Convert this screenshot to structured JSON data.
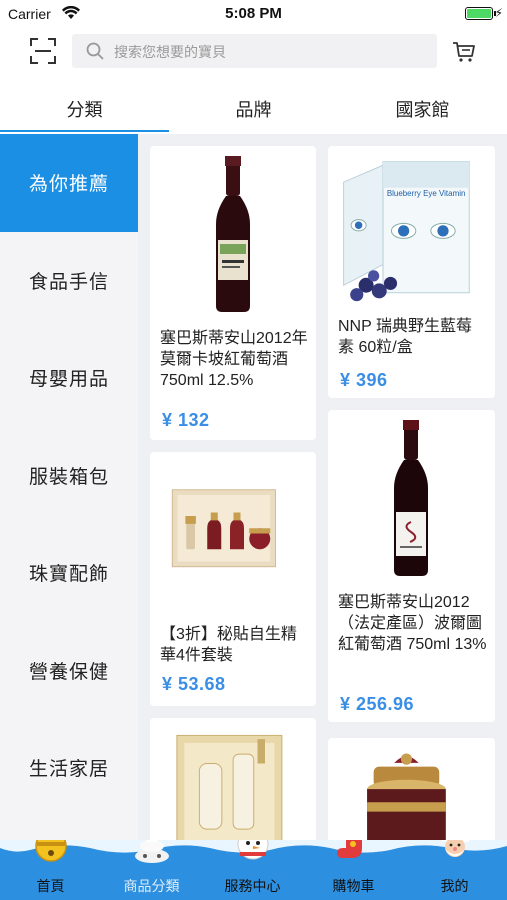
{
  "status_bar": {
    "carrier": "Carrier",
    "time": "5:08 PM"
  },
  "search": {
    "placeholder": "搜索您想要的寶貝"
  },
  "tabs": [
    {
      "label": "分類",
      "active": true
    },
    {
      "label": "品牌",
      "active": false
    },
    {
      "label": "國家館",
      "active": false
    }
  ],
  "sidebar": {
    "items": [
      {
        "label": "為你推薦",
        "active": true
      },
      {
        "label": "食品手信",
        "active": false
      },
      {
        "label": "母嬰用品",
        "active": false
      },
      {
        "label": "服裝箱包",
        "active": false
      },
      {
        "label": "珠寶配飾",
        "active": false
      },
      {
        "label": "營養保健",
        "active": false
      },
      {
        "label": "生活家居",
        "active": false
      }
    ]
  },
  "products": [
    {
      "name": "塞巴斯蒂安山2012年莫爾卡坡紅葡萄酒 750ml 12.5%",
      "price": "¥ 132",
      "image": "red-wine-bottle"
    },
    {
      "name": "NNP 瑞典野生藍莓素 60粒/盒",
      "price": "¥ 396",
      "image": "blueberry-supplement-box",
      "box_text": "Blueberry Eye Vitamin"
    },
    {
      "name": "【3折】秘貼自生精華4件套裝",
      "price": "¥ 53.68",
      "image": "skincare-set"
    },
    {
      "name": "塞巴斯蒂安山2012（法定產區）波爾圖紅葡萄酒 750ml 13%",
      "price": "¥ 256.96",
      "image": "red-wine-bottle-white-label"
    },
    {
      "name": "",
      "price": "",
      "image": "skincare-gift-box"
    },
    {
      "name": "",
      "price": "",
      "image": "cream-jar"
    }
  ],
  "bottom_nav": [
    {
      "label": "首頁",
      "icon": "bell-icon",
      "active": false
    },
    {
      "label": "商品分類",
      "icon": "snowman-stack-icon",
      "active": true
    },
    {
      "label": "服務中心",
      "icon": "snowman-icon",
      "active": false
    },
    {
      "label": "購物車",
      "icon": "stocking-icon",
      "active": false
    },
    {
      "label": "我的",
      "icon": "santa-icon",
      "active": false
    }
  ],
  "colors": {
    "accent": "#1a8fe3",
    "price": "#3a8ee6",
    "tabbar": "#2d8fe0"
  }
}
